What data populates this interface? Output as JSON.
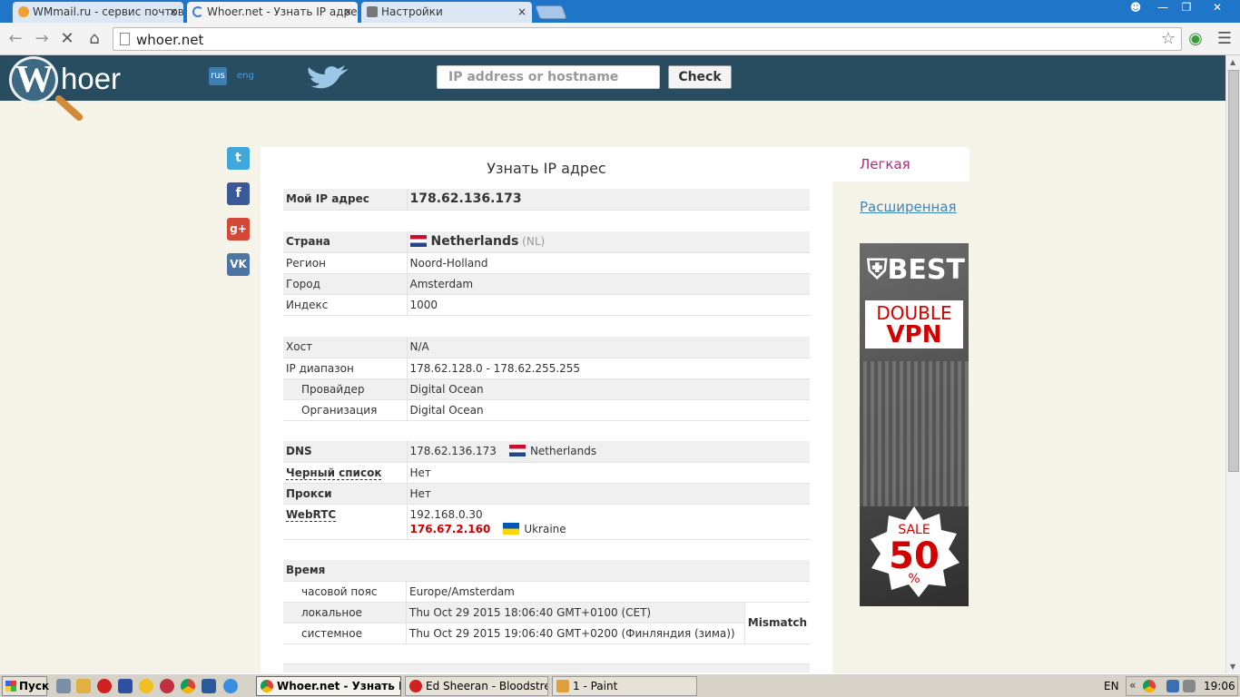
{
  "browser": {
    "tabs": [
      {
        "label": "WMmail.ru - сервис почтовь",
        "close": "×"
      },
      {
        "label": "Whoer.net - Узнать IP адре",
        "close": "×"
      },
      {
        "label": "Настройки",
        "close": "×"
      }
    ],
    "url": "whoer.net"
  },
  "header": {
    "logo_w": "W",
    "logo_text": "hoer",
    "lang_rus": "rus",
    "lang_eng": "eng",
    "search_placeholder": "IP address or hostname",
    "check_label": "Check"
  },
  "social": [
    "t",
    "f",
    "g+",
    "VK"
  ],
  "main": {
    "title": "Узнать IP адрес",
    "my_ip_label": "Мой IP адрес",
    "my_ip": "178.62.136.173",
    "country_label": "Страна",
    "country": "Netherlands",
    "country_code": "(NL)",
    "region_label": "Регион",
    "region": "Noord-Holland",
    "city_label": "Город",
    "city": "Amsterdam",
    "zip_label": "Индекс",
    "zip": "1000",
    "host_label": "Хост",
    "host": "N/A",
    "range_label": "IP диапазон",
    "range": "178.62.128.0 - 178.62.255.255",
    "provider_label": "Провайдер",
    "provider": "Digital Ocean",
    "org_label": "Организация",
    "org": "Digital Ocean",
    "dns_label": "DNS",
    "dns": "178.62.136.173",
    "dns_country": "Netherlands",
    "blacklist_label": "Черный список",
    "blacklist": "Нет",
    "proxy_label": "Прокси",
    "proxy": "Нет",
    "webrtc_label": "WebRTC",
    "webrtc_local": "192.168.0.30",
    "webrtc_public": "176.67.2.160",
    "webrtc_country": "Ukraine",
    "time_label": "Время",
    "tz_label": "часовой пояс",
    "tz": "Europe/Amsterdam",
    "local_label": "локальное",
    "local": "Thu Oct 29 2015 18:06:40 GMT+0100 (CET)",
    "system_label": "системное",
    "system": "Thu Oct 29 2015 19:06:40 GMT+0200 (Финляндия (зима))",
    "mismatch": "Mismatch"
  },
  "sidebar": {
    "tab_easy": "Легкая",
    "tab_extended": "Расширенная"
  },
  "ad": {
    "best": "BEST",
    "double": "DOUBLE",
    "vpn": "VPN",
    "sale": "SALE",
    "fifty": "50",
    "pct": "%"
  },
  "taskbar": {
    "start": "Пуск",
    "tasks": [
      "Whoer.net - Узнать I...",
      "Ed Sheeran - Bloodstrea...",
      "1 - Paint"
    ],
    "lang": "EN",
    "clock": "19:06"
  }
}
